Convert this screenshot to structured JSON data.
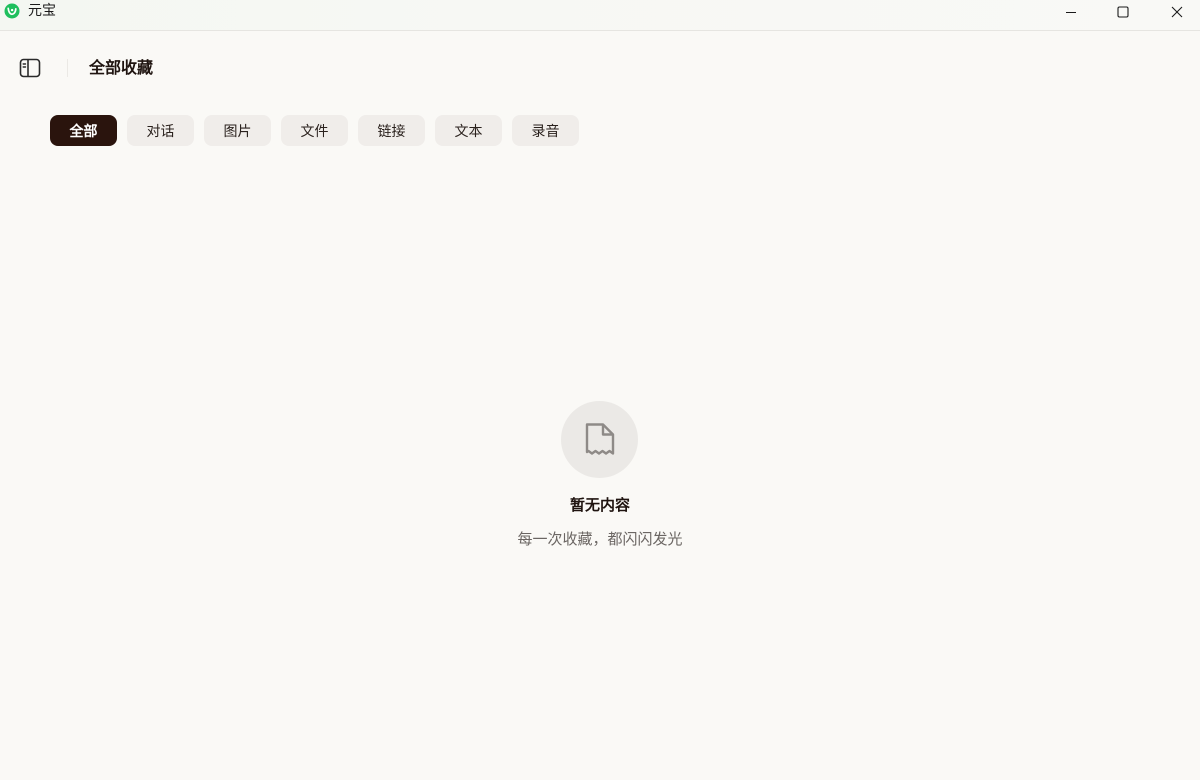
{
  "window": {
    "title": "元宝",
    "accent_color": "#22c55e"
  },
  "header": {
    "title": "全部收藏"
  },
  "filters": {
    "active_color": "#2a140d",
    "items": [
      {
        "label": "全部",
        "active": true
      },
      {
        "label": "对话",
        "active": false
      },
      {
        "label": "图片",
        "active": false
      },
      {
        "label": "文件",
        "active": false
      },
      {
        "label": "链接",
        "active": false
      },
      {
        "label": "文本",
        "active": false
      },
      {
        "label": "录音",
        "active": false
      }
    ]
  },
  "empty_state": {
    "icon": "document-icon",
    "title": "暂无内容",
    "subtitle": "每一次收藏，都闪闪发光"
  }
}
